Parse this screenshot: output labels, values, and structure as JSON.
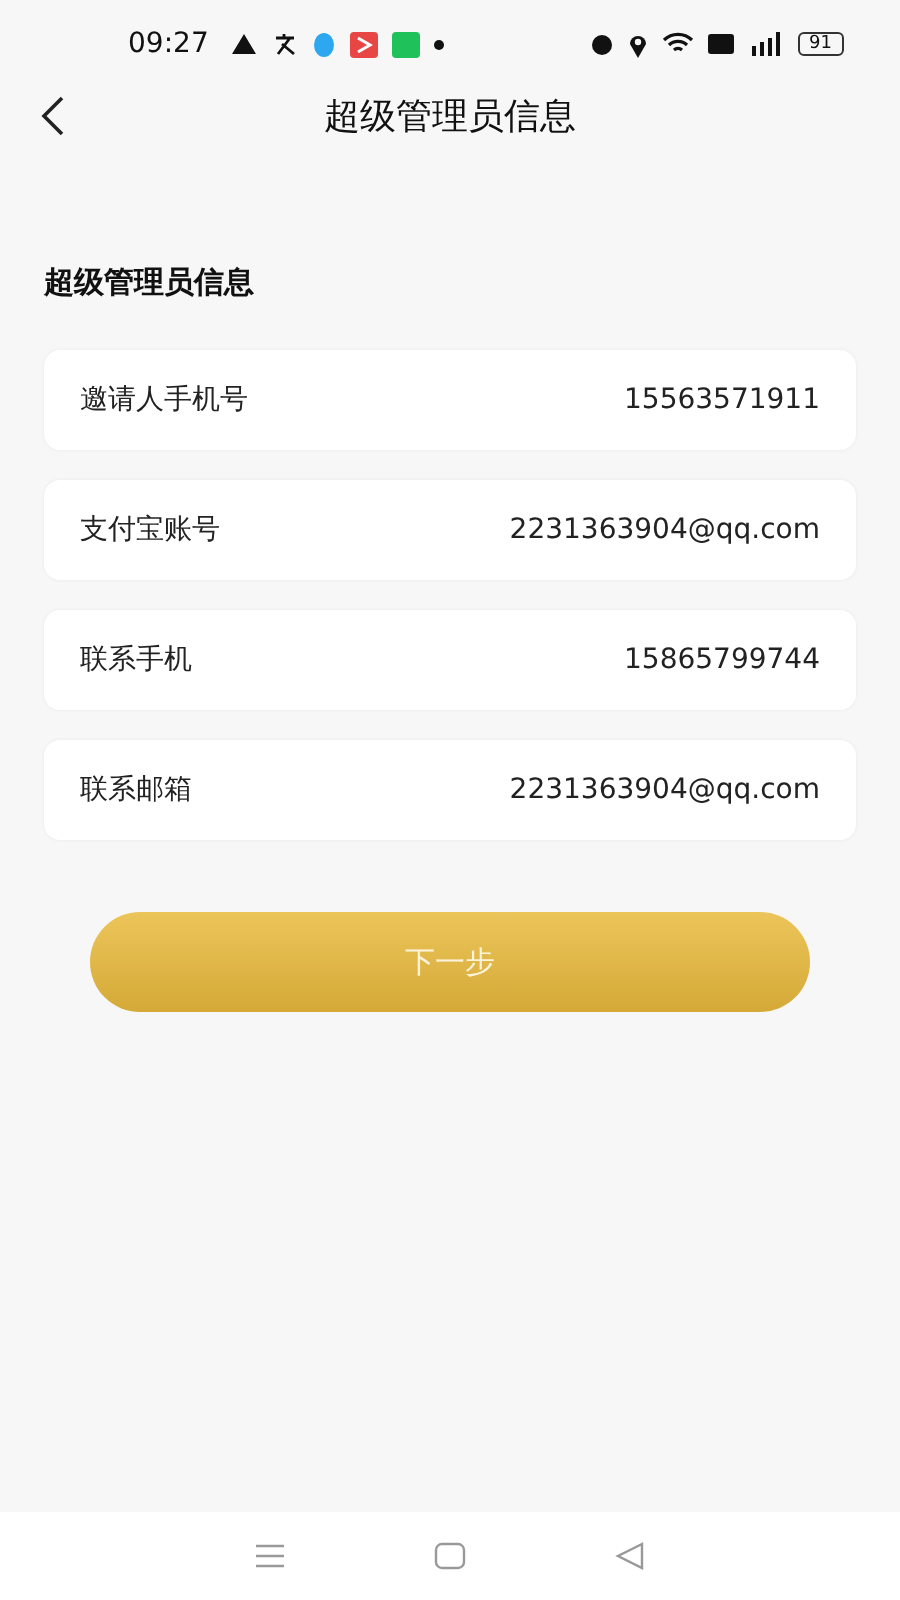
{
  "status_bar": {
    "time": "09:27",
    "battery": "91"
  },
  "header": {
    "title": "超级管理员信息"
  },
  "section_title": "超级管理员信息",
  "rows": [
    {
      "label": "邀请人手机号",
      "value": "15563571911"
    },
    {
      "label": "支付宝账号",
      "value": "2231363904@qq.com"
    },
    {
      "label": "联系手机",
      "value": "15865799744"
    },
    {
      "label": "联系邮箱",
      "value": "2231363904@qq.com"
    }
  ],
  "next_button": {
    "label": "下一步"
  }
}
